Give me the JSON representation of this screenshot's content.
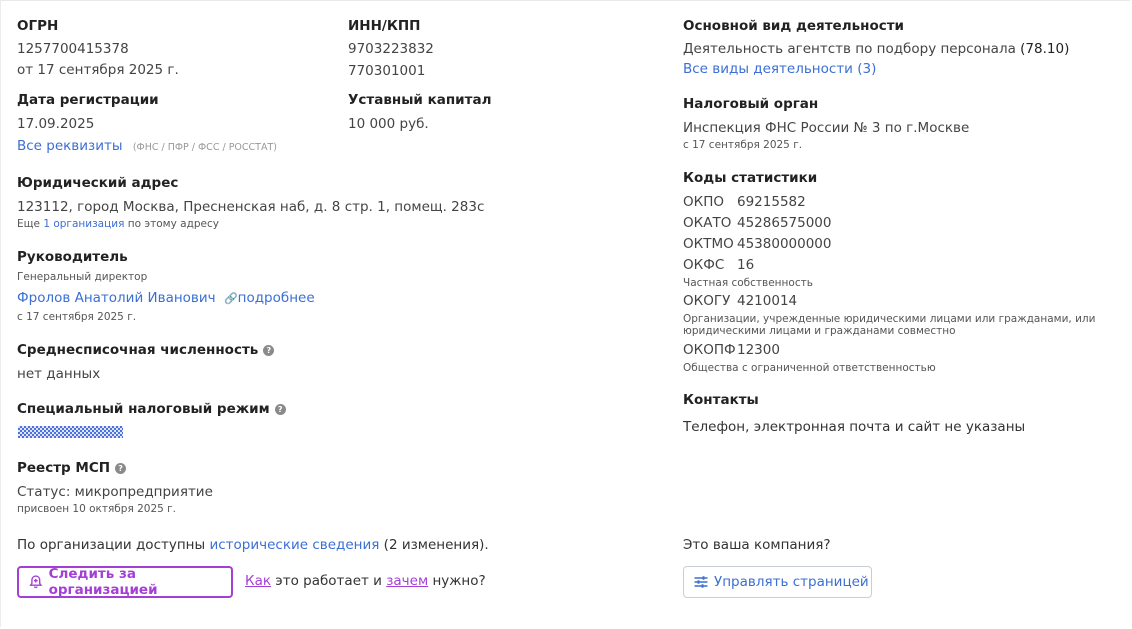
{
  "ogrn": {
    "label": "ОГРН",
    "value": "1257700415378",
    "date": "от 17 сентября 2025 г."
  },
  "inn_kpp": {
    "label": "ИНН/КПП",
    "inn": "9703223832",
    "kpp": "770301001"
  },
  "reg_date": {
    "label": "Дата регистрации",
    "value": "17.09.2025"
  },
  "capital": {
    "label": "Уставный капитал",
    "value": "10 000 руб."
  },
  "requisites": {
    "link": "Все реквизиты",
    "note": "(ФНС / ПФР / ФСС / РОССТАТ)"
  },
  "address": {
    "label": "Юридический адрес",
    "value": "123112, город Москва, Пресненская наб, д. 8 стр. 1, помещ. 283с",
    "more_prefix": "Еще ",
    "more_link": "1 организация",
    "more_suffix": " по этому адресу"
  },
  "head": {
    "label": "Руководитель",
    "position": "Генеральный директор",
    "name": "Фролов Анатолий Иванович",
    "details": "подробнее",
    "since": "с 17 сентября 2025 г."
  },
  "headcount": {
    "label": "Среднесписочная численность",
    "value": "нет данных"
  },
  "tax_regime": {
    "label": "Специальный налоговый режим"
  },
  "msp": {
    "label": "Реестр МСП",
    "status": "Статус: микропредприятие",
    "assigned": "присвоен 10 октября 2025 г."
  },
  "history": {
    "prefix": "По организации доступны ",
    "link": "исторические сведения",
    "suffix": " (2 изменения)."
  },
  "follow": {
    "button": "Следить за организацией",
    "how": "Как",
    "mid": " это работает и ",
    "why": "зачем",
    "end": " нужно?"
  },
  "activity": {
    "label": "Основной вид деятельности",
    "value": "Деятельность агентств по подбору персонала",
    "code": "(78.10)",
    "all": "Все виды деятельности (3)"
  },
  "tax_office": {
    "label": "Налоговый орган",
    "value": "Инспекция ФНС России № 3 по г.Москве",
    "since": "с 17 сентября 2025 г."
  },
  "stats": {
    "label": "Коды статистики",
    "okpo": {
      "k": "ОКПО",
      "v": "69215582"
    },
    "okato": {
      "k": "ОКАТО",
      "v": "45286575000"
    },
    "oktmo": {
      "k": "ОКТМО",
      "v": "45380000000"
    },
    "okfs": {
      "k": "ОКФС",
      "v": "16",
      "desc": "Частная собственность"
    },
    "okogu": {
      "k": "ОКОГУ",
      "v": "4210014",
      "desc1": "Организации, учрежденные юридическими лицами или гражданами, или",
      "desc2": "юридическими лицами и гражданами совместно"
    },
    "okopf": {
      "k": "ОКОПФ",
      "v": "12300",
      "desc": "Общества с ограниченной ответственностью"
    }
  },
  "contacts": {
    "label": "Контакты",
    "value": "Телефон, электронная почта и сайт не указаны"
  },
  "own": {
    "question": "Это ваша компания?",
    "button": "Управлять страницей"
  },
  "colors": {
    "link": "#3b6fd4",
    "accent": "#a43fd6"
  }
}
